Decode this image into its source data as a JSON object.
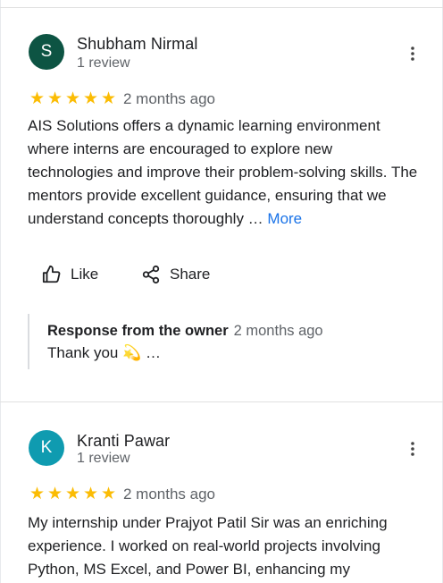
{
  "reviews": [
    {
      "avatar_letter": "S",
      "avatar_color": "#0d5443",
      "name": "Shubham Nirmal",
      "review_count": "1 review",
      "rating": 5,
      "stars": "★★★★★",
      "date": "2 months ago",
      "text": "AIS Solutions offers a dynamic learning environment where interns are encouraged to explore new technologies and improve their problem-solving skills. The mentors provide excellent guidance, ensuring that we understand concepts thoroughly …",
      "more_label": "More",
      "like_label": "Like",
      "share_label": "Share",
      "response": {
        "title": "Response from the owner",
        "date": "2 months ago",
        "text": "Thank you 💫 …"
      }
    },
    {
      "avatar_letter": "K",
      "avatar_color": "#0f9bb0",
      "name": "Kranti Pawar",
      "review_count": "1 review",
      "rating": 5,
      "stars": "★★★★★",
      "date": "2 months ago",
      "text": "My internship under Prajyot Patil Sir was an enriching experience. I worked on real-world projects involving Python, MS Excel, and Power BI, enhancing my"
    }
  ],
  "colors": {
    "star": "#fbbc04",
    "link": "#1a73e8",
    "secondary_text": "#5f6368"
  }
}
